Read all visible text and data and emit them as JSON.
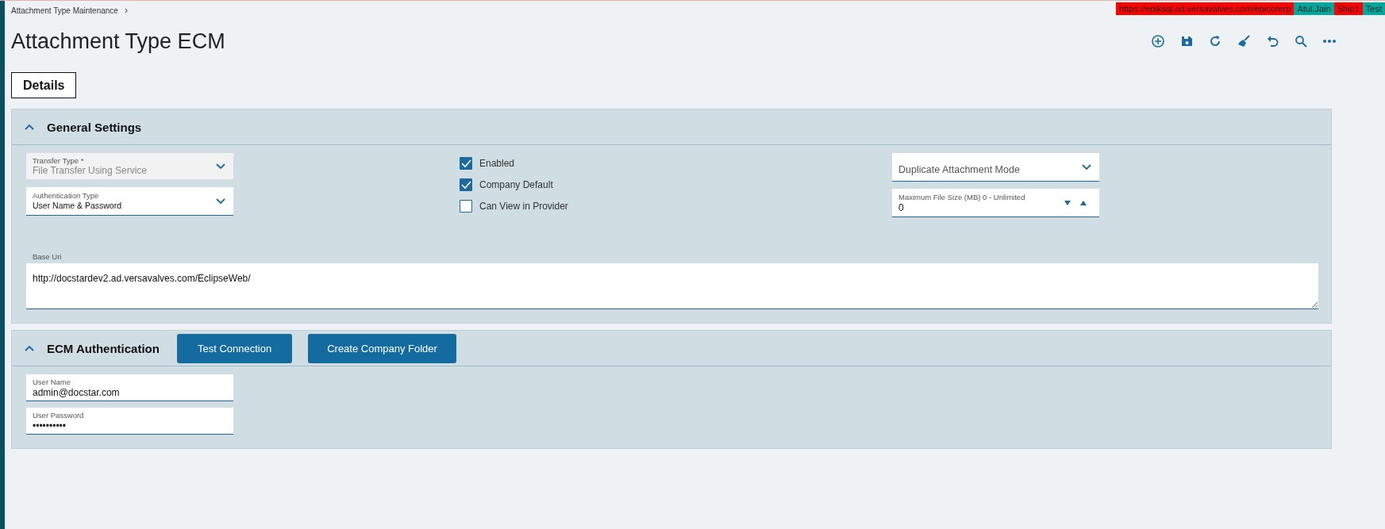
{
  "breadcrumb": {
    "label": "Attachment Type Maintenance",
    "separator": "›"
  },
  "environment_badges": [
    {
      "text": "https://epiksql.ad.versavalves.com/epicorerp",
      "color": "#ff0000"
    },
    {
      "text": "Atul.Jain",
      "color": "#00a99d"
    },
    {
      "text": "Ship1",
      "color": "#ff0000"
    },
    {
      "text": "Test",
      "color": "#00a99d"
    }
  ],
  "title": "Attachment Type ECM",
  "toolbar": [
    {
      "kind": "add"
    },
    {
      "kind": "save"
    },
    {
      "kind": "refresh"
    },
    {
      "kind": "clear"
    },
    {
      "kind": "undo"
    },
    {
      "kind": "search"
    },
    {
      "kind": "more"
    }
  ],
  "tabs": [
    {
      "label": "Details",
      "selected": true
    }
  ],
  "general_settings": {
    "title": "General Settings",
    "expanded": true,
    "transfer_type": {
      "label": "Transfer Type *",
      "value": "File Transfer Using Service",
      "disabled": true
    },
    "authentication_type": {
      "label": "Authentication Type",
      "value": "User Name & Password",
      "disabled": false
    },
    "checkboxes": [
      {
        "label": "Enabled",
        "checked": true
      },
      {
        "label": "Company Default",
        "checked": true
      },
      {
        "label": "Can View in Provider",
        "checked": false
      }
    ],
    "duplicate_attachment_mode": {
      "placeholder": "Duplicate Attachment Mode"
    },
    "maximum_file_size": {
      "label": "Maximum File Size (MB) 0 - Unlimited",
      "value": "0"
    },
    "base_uri": {
      "label": "Base Uri",
      "value": "http://docstardev2.ad.versavalves.com/EclipseWeb/"
    }
  },
  "ecm_authentication": {
    "title": "ECM Authentication",
    "expanded": true,
    "buttons": [
      "Test Connection",
      "Create Company Folder"
    ],
    "user_name": {
      "label": "User Name",
      "value": "admin@docstar.com"
    },
    "user_password": {
      "label": "User Password",
      "value": "••••••••••"
    }
  }
}
